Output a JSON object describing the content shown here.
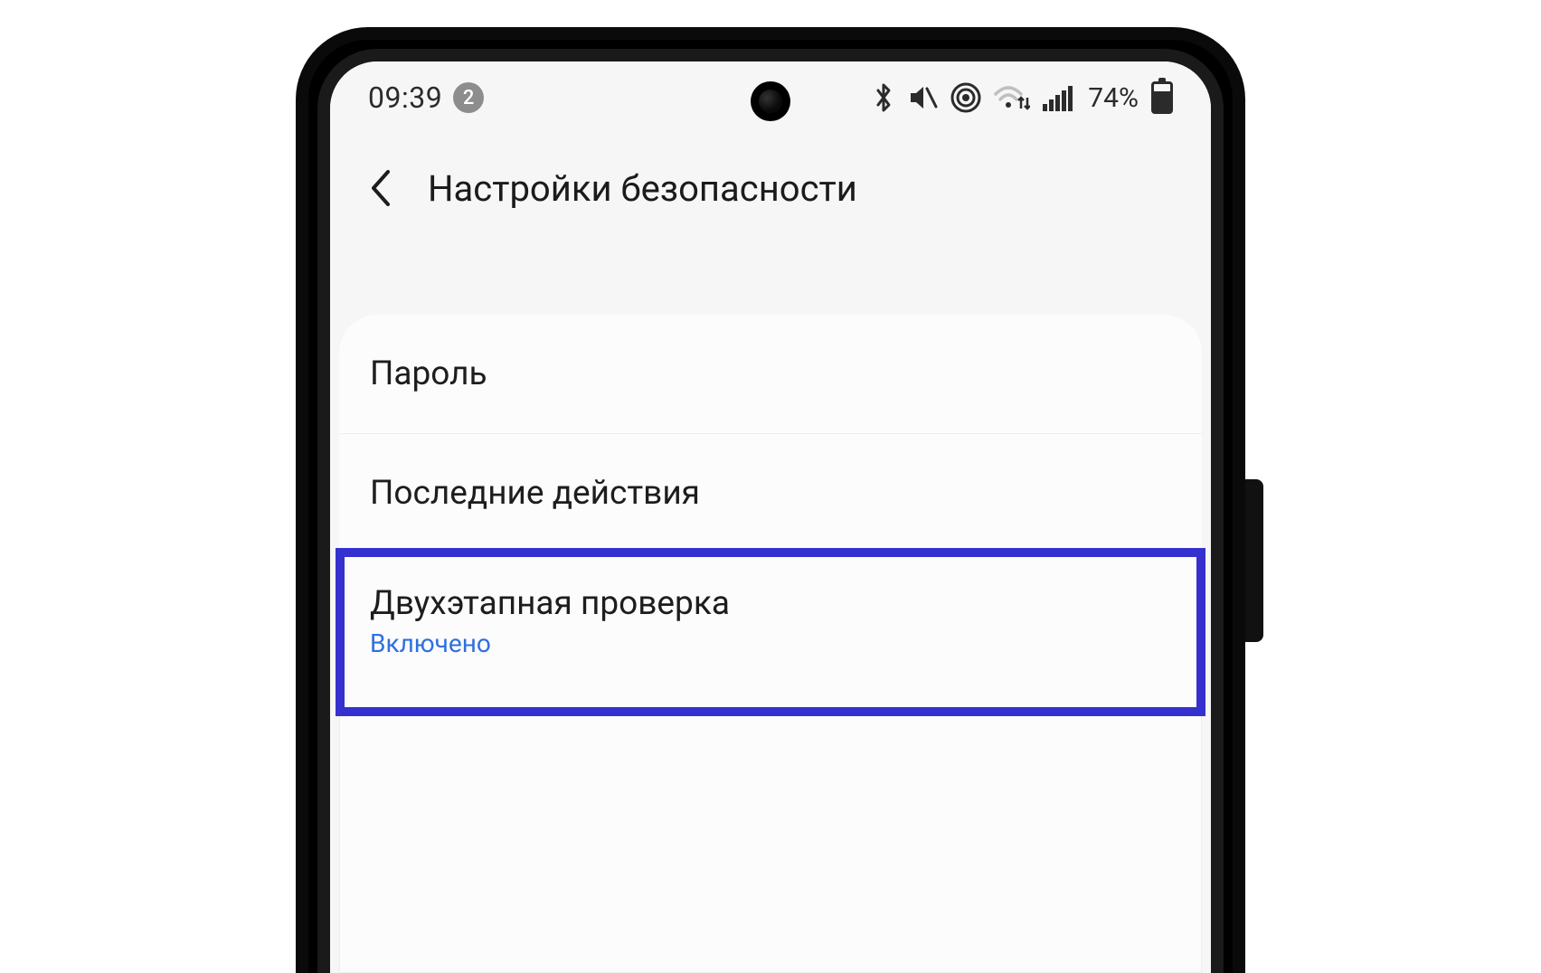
{
  "status": {
    "time": "09:39",
    "notification_count": "2",
    "battery_percent": "74%"
  },
  "header": {
    "title": "Настройки безопасности"
  },
  "items": [
    {
      "title": "Пароль"
    },
    {
      "title": "Последние действия"
    },
    {
      "title": "Двухэтапная проверка",
      "subtitle": "Включено"
    }
  ]
}
